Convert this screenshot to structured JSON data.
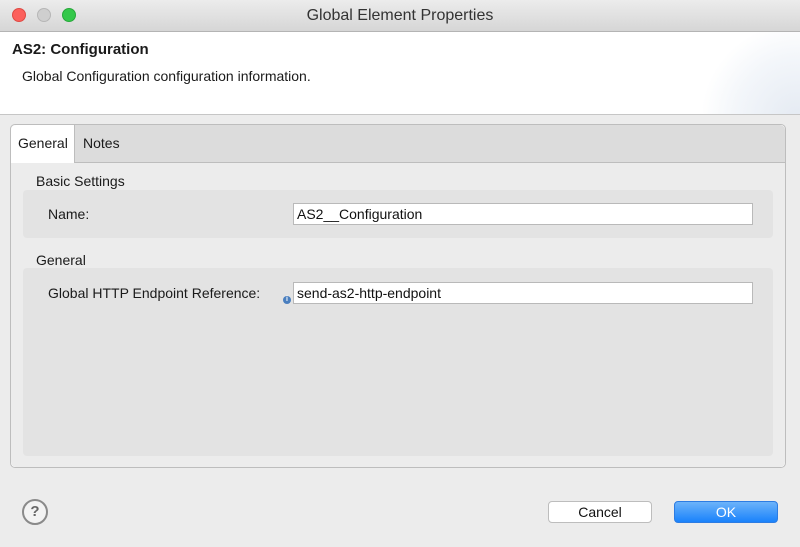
{
  "window": {
    "title": "Global Element Properties"
  },
  "header": {
    "title": "AS2: Configuration",
    "description": "Global Configuration configuration information."
  },
  "tabs": [
    {
      "label": "General",
      "active": true
    },
    {
      "label": "Notes",
      "active": false
    }
  ],
  "sections": {
    "basic": {
      "label": "Basic Settings",
      "name_label": "Name:",
      "name_value": "AS2__Configuration"
    },
    "general": {
      "label": "General",
      "endpoint_label": "Global HTTP Endpoint Reference:",
      "endpoint_value": "send-as2-http-endpoint"
    }
  },
  "footer": {
    "help_symbol": "?",
    "cancel_label": "Cancel",
    "ok_label": "OK"
  },
  "colors": {
    "ok_button": "#1a82fb",
    "close": "#fc605c",
    "maximize": "#34c84a"
  }
}
